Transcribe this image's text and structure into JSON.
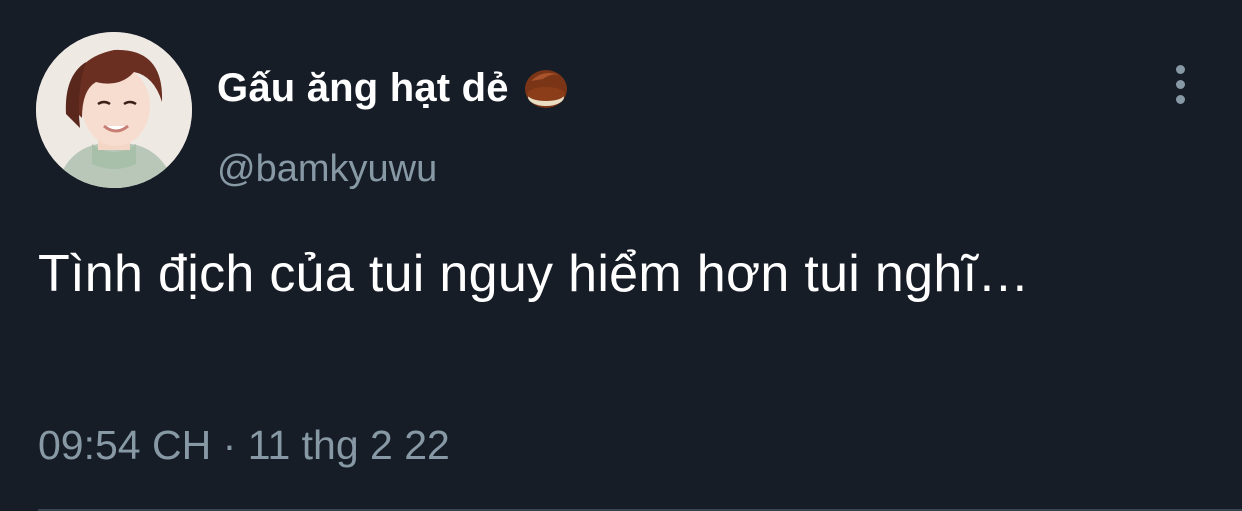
{
  "tweet": {
    "author": {
      "display_name": "Gấu ăng hạt dẻ",
      "handle": "@bamkyuwu",
      "name_emoji": "chestnut-icon"
    },
    "text": "Tình địch của tui nguy hiểm hơn tui nghĩ…",
    "time": "09:54 CH",
    "separator": "·",
    "date": "11 thg 2 22"
  },
  "colors": {
    "background": "#161d27",
    "primary_text": "#ffffff",
    "secondary_text": "#8899a6",
    "divider": "#38444d"
  }
}
